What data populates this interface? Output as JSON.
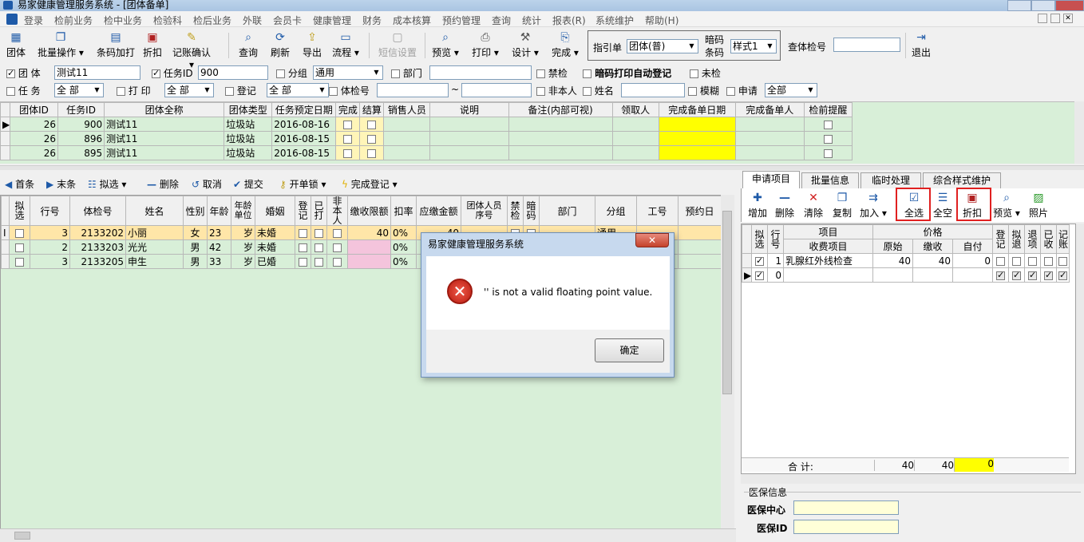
{
  "window": {
    "title": "易家健康管理服务系统 - [团体备单]"
  },
  "menu": [
    "登录",
    "检前业务",
    "检中业务",
    "检验科",
    "检后业务",
    "外联",
    "会员卡",
    "健康管理",
    "财务",
    "成本核算",
    "预约管理",
    "查询",
    "统计",
    "报表(R)",
    "系统维护",
    "帮助(H)"
  ],
  "toolbar": {
    "group": "团体",
    "batch_op": "批量操作",
    "barcode_print": "条码加打",
    "discount": "折扣",
    "bill_confirm": "记账确认",
    "query": "查询",
    "refresh": "刷新",
    "export": "导出",
    "flow": "流程",
    "sms": "短信设置",
    "preview": "预览",
    "print": "打印",
    "design": "设计",
    "complete": "完成",
    "guide_label": "指引单",
    "guide_value": "团体(普)",
    "code_label1": "暗码",
    "code_label2": "条码",
    "style_value": "样式1",
    "check_no_label": "查体检号",
    "check_no_value": "",
    "exit": "退出"
  },
  "filters": {
    "group_label": "团 体",
    "group_value": "测试11",
    "task_label": "任务ID",
    "task_value": "900",
    "subgroup_label": "分组",
    "subgroup_value": "通用",
    "dept_label": "部门",
    "dept_value": "",
    "ban_label": "禁检",
    "auto_label": "暗码打印自动登记",
    "unchecked_label": "未检",
    "task2_label": "任 务",
    "task2_value": "全 部",
    "print_label": "打 印",
    "print_value": "全 部",
    "reg_label": "登记",
    "reg_value": "全 部",
    "examno_label": "体检号",
    "examno_from": "",
    "tilde": "~",
    "examno_to": "",
    "nonself_label": "非本人",
    "name_label": "姓名",
    "name_value": "",
    "fuzzy_label": "模糊",
    "apply_label": "申请",
    "apply_value": "全部"
  },
  "grid1": {
    "headers": [
      "团体ID",
      "任务ID",
      "团体全称",
      "团体类型",
      "任务预定日期",
      "完成",
      "结算",
      "销售人员",
      "说明",
      "备注(内部可视)",
      "领取人",
      "完成备单日期",
      "完成备单人",
      "检前提醒"
    ],
    "rows": [
      [
        "26",
        "900",
        "测试11",
        "垃圾站",
        "2016-08-16"
      ],
      [
        "26",
        "896",
        "测试11",
        "垃圾站",
        "2016-08-15"
      ],
      [
        "26",
        "895",
        "测试11",
        "垃圾站",
        "2016-08-15"
      ]
    ]
  },
  "left_toolbar": {
    "first": "首条",
    "last": "末条",
    "select": "拟选",
    "delete": "删除",
    "cancel": "取消",
    "submit": "提交",
    "unlock": "开单锁",
    "finish_reg": "完成登记"
  },
  "grid2": {
    "headers": [
      "拟选",
      "行号",
      "体检号",
      "姓名",
      "性别",
      "年龄",
      "年龄单位",
      "婚姻",
      "登记",
      "已打",
      "非本人",
      "缴收限额",
      "扣率",
      "应缴金额",
      "团体人员序号",
      "禁检",
      "暗码",
      "部门",
      "分组",
      "工号",
      "预约日"
    ],
    "rows": [
      [
        "3",
        "2133202",
        "小丽",
        "女",
        "23",
        "岁",
        "未婚",
        "40",
        "0%",
        "40",
        "通用"
      ],
      [
        "2",
        "2133203",
        "光光",
        "男",
        "42",
        "岁",
        "未婚",
        "",
        "0%",
        "",
        ""
      ],
      [
        "3",
        "2133205",
        "申生",
        "男",
        "33",
        "岁",
        "已婚",
        "",
        "0%",
        "",
        ""
      ]
    ]
  },
  "right_tabs": [
    "申请项目",
    "批量信息",
    "临时处理",
    "综合样式维护"
  ],
  "right_toolbar": {
    "add": "增加",
    "delete": "删除",
    "clear": "清除",
    "copy": "复制",
    "join": "加入",
    "select_all": "全选",
    "clear_all": "全空",
    "discount": "折扣",
    "preview": "预览",
    "photo": "照片"
  },
  "grid3": {
    "headers": {
      "select": "拟选",
      "row": "行号",
      "item": "项目",
      "charge_item": "收费项目",
      "price": "价格",
      "orig": "原始",
      "paid": "缴收",
      "self": "自付",
      "reg": "登记",
      "plan_refund": "拟退",
      "refund": "退项",
      "received": "已收",
      "bill": "记账"
    },
    "rows": [
      [
        "1",
        "乳腺红外线检查",
        "40",
        "40",
        "0"
      ],
      [
        "0",
        "",
        "",
        "",
        ""
      ]
    ],
    "total_label": "合 计:",
    "total_orig": "40",
    "total_paid": "40",
    "total_self": "0"
  },
  "medical": {
    "title": "医保信息",
    "center_label": "医保中心",
    "center_value": "",
    "id_label": "医保ID",
    "id_value": ""
  },
  "dialog": {
    "title": "易家健康管理服务系统",
    "message": "'' is not a valid floating point value.",
    "ok": "确定",
    "close": "✕"
  }
}
